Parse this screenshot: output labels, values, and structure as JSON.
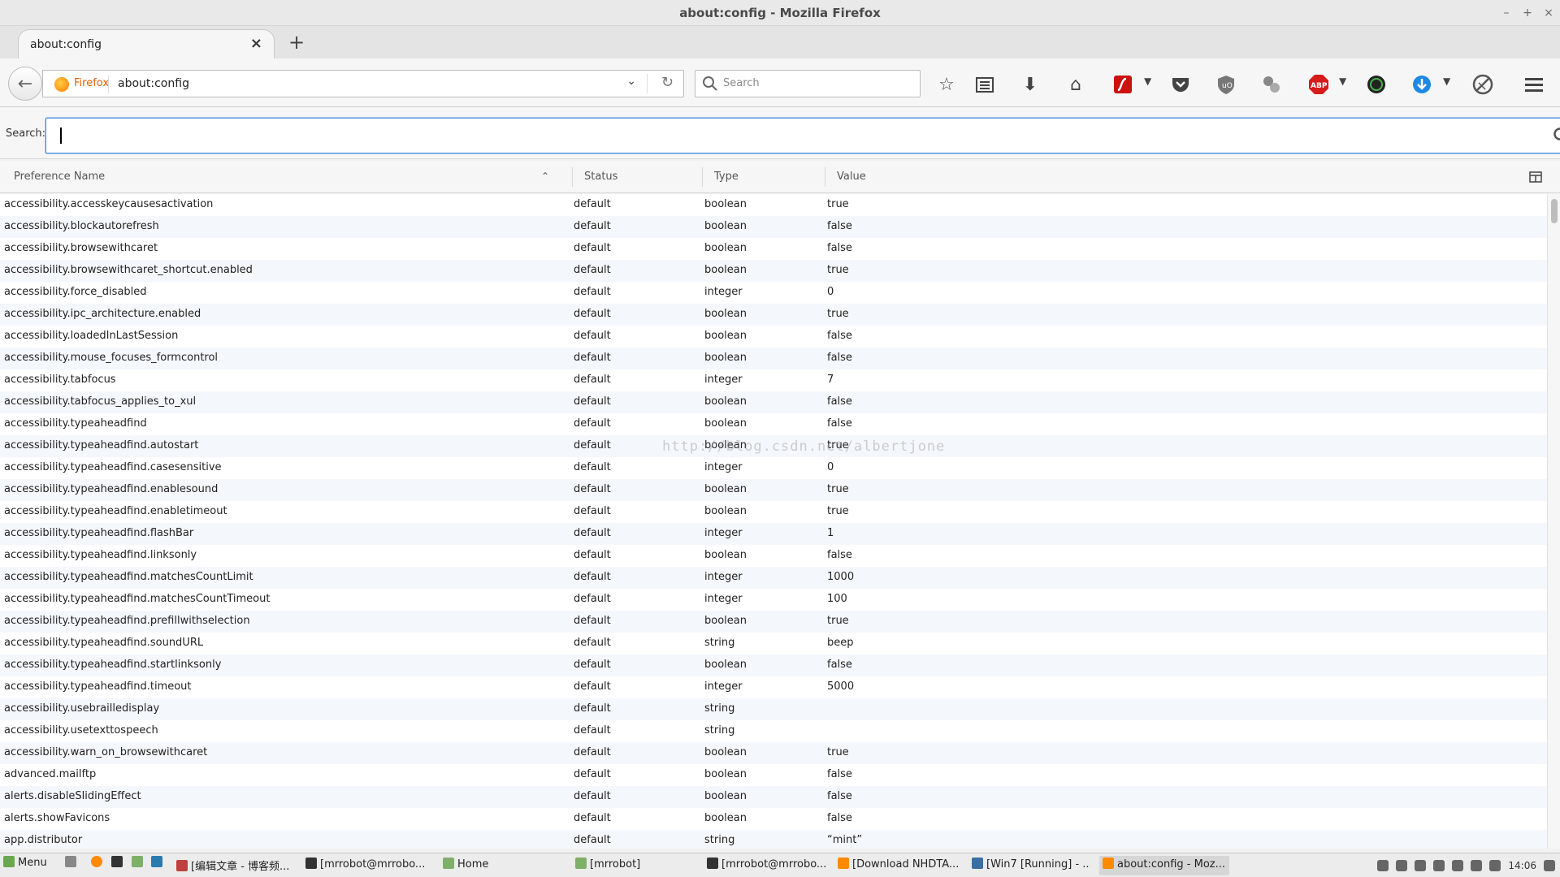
{
  "window": {
    "title": "about:config - Mozilla Firefox",
    "controls": [
      "–",
      "+",
      "×"
    ]
  },
  "tabs": [
    {
      "label": "about:config",
      "close": "×"
    }
  ],
  "newtab": "+",
  "navbar": {
    "identity": "Firefox",
    "url": "about:config",
    "search_placeholder": "Search"
  },
  "toolbar_icons": [
    "bookmark-star-icon",
    "reading-list-icon",
    "download-icon",
    "home-icon",
    "flash-icon",
    "pocket-icon",
    "ublock-icon",
    "extension-icon",
    "adblock-plus-icon",
    "dark-reader-icon",
    "download-manager-icon",
    "privacy-icon",
    "hamburger-menu-icon"
  ],
  "abp_label": "ABP",
  "config_search": {
    "label": "Search:",
    "value": ""
  },
  "columns": {
    "name": "Preference Name",
    "status": "Status",
    "type": "Type",
    "value": "Value"
  },
  "preferences": [
    {
      "name": "accessibility.accesskeycausesactivation",
      "status": "default",
      "type": "boolean",
      "value": "true"
    },
    {
      "name": "accessibility.blockautorefresh",
      "status": "default",
      "type": "boolean",
      "value": "false"
    },
    {
      "name": "accessibility.browsewithcaret",
      "status": "default",
      "type": "boolean",
      "value": "false"
    },
    {
      "name": "accessibility.browsewithcaret_shortcut.enabled",
      "status": "default",
      "type": "boolean",
      "value": "true"
    },
    {
      "name": "accessibility.force_disabled",
      "status": "default",
      "type": "integer",
      "value": "0"
    },
    {
      "name": "accessibility.ipc_architecture.enabled",
      "status": "default",
      "type": "boolean",
      "value": "true"
    },
    {
      "name": "accessibility.loadedInLastSession",
      "status": "default",
      "type": "boolean",
      "value": "false"
    },
    {
      "name": "accessibility.mouse_focuses_formcontrol",
      "status": "default",
      "type": "boolean",
      "value": "false"
    },
    {
      "name": "accessibility.tabfocus",
      "status": "default",
      "type": "integer",
      "value": "7"
    },
    {
      "name": "accessibility.tabfocus_applies_to_xul",
      "status": "default",
      "type": "boolean",
      "value": "false"
    },
    {
      "name": "accessibility.typeaheadfind",
      "status": "default",
      "type": "boolean",
      "value": "false"
    },
    {
      "name": "accessibility.typeaheadfind.autostart",
      "status": "default",
      "type": "boolean",
      "value": "true"
    },
    {
      "name": "accessibility.typeaheadfind.casesensitive",
      "status": "default",
      "type": "integer",
      "value": "0"
    },
    {
      "name": "accessibility.typeaheadfind.enablesound",
      "status": "default",
      "type": "boolean",
      "value": "true"
    },
    {
      "name": "accessibility.typeaheadfind.enabletimeout",
      "status": "default",
      "type": "boolean",
      "value": "true"
    },
    {
      "name": "accessibility.typeaheadfind.flashBar",
      "status": "default",
      "type": "integer",
      "value": "1"
    },
    {
      "name": "accessibility.typeaheadfind.linksonly",
      "status": "default",
      "type": "boolean",
      "value": "false"
    },
    {
      "name": "accessibility.typeaheadfind.matchesCountLimit",
      "status": "default",
      "type": "integer",
      "value": "1000"
    },
    {
      "name": "accessibility.typeaheadfind.matchesCountTimeout",
      "status": "default",
      "type": "integer",
      "value": "100"
    },
    {
      "name": "accessibility.typeaheadfind.prefillwithselection",
      "status": "default",
      "type": "boolean",
      "value": "true"
    },
    {
      "name": "accessibility.typeaheadfind.soundURL",
      "status": "default",
      "type": "string",
      "value": "beep"
    },
    {
      "name": "accessibility.typeaheadfind.startlinksonly",
      "status": "default",
      "type": "boolean",
      "value": "false"
    },
    {
      "name": "accessibility.typeaheadfind.timeout",
      "status": "default",
      "type": "integer",
      "value": "5000"
    },
    {
      "name": "accessibility.usebrailledisplay",
      "status": "default",
      "type": "string",
      "value": ""
    },
    {
      "name": "accessibility.usetexttospeech",
      "status": "default",
      "type": "string",
      "value": ""
    },
    {
      "name": "accessibility.warn_on_browsewithcaret",
      "status": "default",
      "type": "boolean",
      "value": "true"
    },
    {
      "name": "advanced.mailftp",
      "status": "default",
      "type": "boolean",
      "value": "false"
    },
    {
      "name": "alerts.disableSlidingEffect",
      "status": "default",
      "type": "boolean",
      "value": "false"
    },
    {
      "name": "alerts.showFavicons",
      "status": "default",
      "type": "boolean",
      "value": "false"
    },
    {
      "name": "app.distributor",
      "status": "default",
      "type": "string",
      "value": "“mint”"
    }
  ],
  "watermark": "http://blog.csdn.net/albertjone",
  "taskbar": {
    "menu_label": "Menu",
    "items": [
      {
        "label": "[编辑文章 - 博客频...",
        "active": false
      },
      {
        "label": "[mrrobot@mrrobo...",
        "active": false
      },
      {
        "label": "Home",
        "active": false
      },
      {
        "label": "[mrrobot]",
        "active": false
      },
      {
        "label": "[mrrobot@mrrobo...",
        "active": false
      },
      {
        "label": "[Download NHDTA...",
        "active": false
      },
      {
        "label": "[Win7 [Running] - ...",
        "active": false
      },
      {
        "label": "about:config - Moz...",
        "active": true
      }
    ],
    "clock": "14:06"
  },
  "colors": {
    "accent": "#4a90d9",
    "identity": "#e66000",
    "row_alt": "#f4f7fb"
  }
}
